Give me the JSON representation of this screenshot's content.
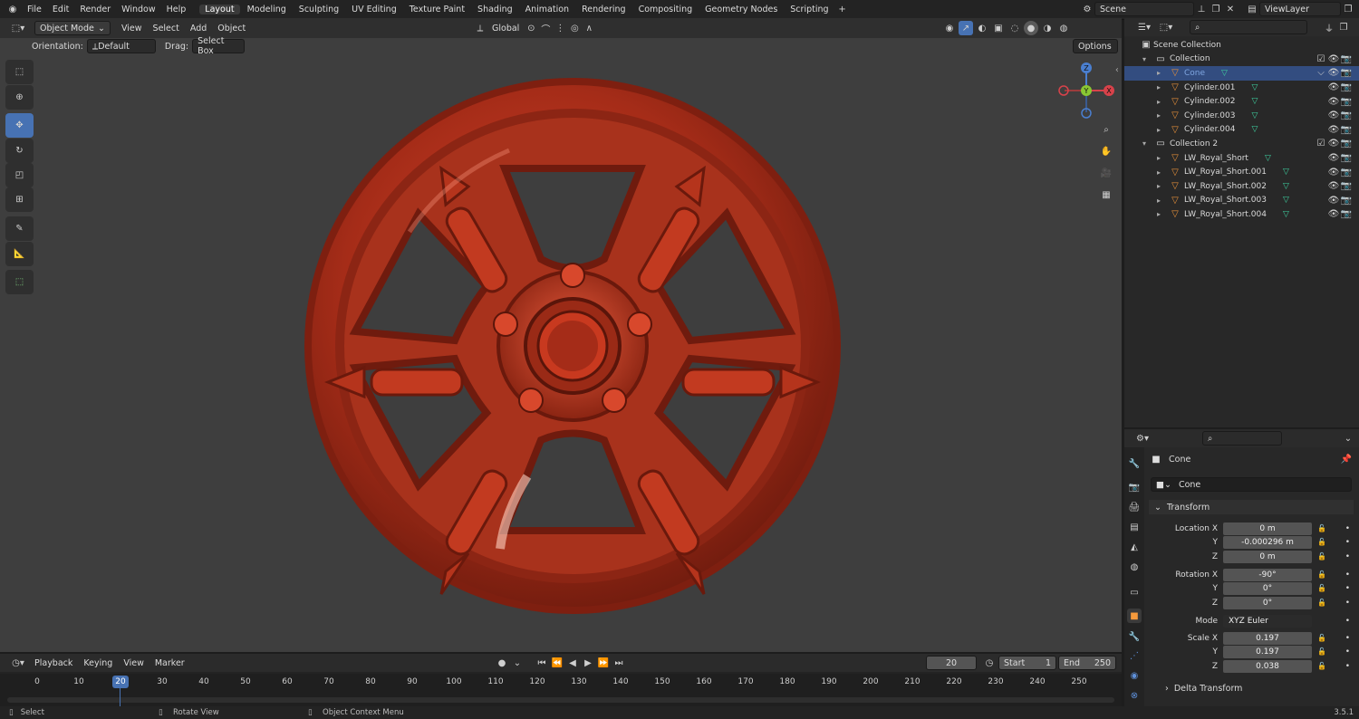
{
  "app": {
    "menus": [
      "File",
      "Edit",
      "Render",
      "Window",
      "Help"
    ],
    "workspaces": [
      "Layout",
      "Modeling",
      "Sculpting",
      "UV Editing",
      "Texture Paint",
      "Shading",
      "Animation",
      "Rendering",
      "Compositing",
      "Geometry Nodes",
      "Scripting"
    ],
    "active_workspace": "Layout",
    "scene": "Scene",
    "view_layer": "ViewLayer"
  },
  "viewport_header": {
    "mode": "Object Mode",
    "menus": [
      "View",
      "Select",
      "Add",
      "Object"
    ],
    "transform_orientation": "Global",
    "options": "Options"
  },
  "tool_options": {
    "orientation_label": "Orientation:",
    "orientation_value": "Default",
    "drag_label": "Drag:",
    "drag_value": "Select Box"
  },
  "tools": [
    "select-box-tool",
    "cursor-tool",
    "move-tool",
    "rotate-tool",
    "scale-tool",
    "transform-tool",
    "annotate-tool",
    "measure-tool",
    "add-cube-tool"
  ],
  "gizmo": {
    "z": "Z",
    "y": "Y",
    "x": "X"
  },
  "outliner": {
    "root": "Scene Collection",
    "items": [
      {
        "name": "Collection",
        "level": 0,
        "type": "collection"
      },
      {
        "name": "Cone",
        "level": 1,
        "type": "object",
        "selected": true
      },
      {
        "name": "Cylinder.001",
        "level": 1,
        "type": "object"
      },
      {
        "name": "Cylinder.002",
        "level": 1,
        "type": "object"
      },
      {
        "name": "Cylinder.003",
        "level": 1,
        "type": "object"
      },
      {
        "name": "Cylinder.004",
        "level": 1,
        "type": "object"
      },
      {
        "name": "Collection 2",
        "level": 0,
        "type": "collection"
      },
      {
        "name": "LW_Royal_Short",
        "level": 1,
        "type": "object"
      },
      {
        "name": "LW_Royal_Short.001",
        "level": 1,
        "type": "object"
      },
      {
        "name": "LW_Royal_Short.002",
        "level": 1,
        "type": "object"
      },
      {
        "name": "LW_Royal_Short.003",
        "level": 1,
        "type": "object"
      },
      {
        "name": "LW_Royal_Short.004",
        "level": 1,
        "type": "object"
      }
    ]
  },
  "properties": {
    "object_name": "Cone",
    "data_name": "Cone",
    "panel": "Transform",
    "delta": "Delta Transform",
    "location": {
      "label": "Location X",
      "x": "0 m",
      "y": "-0.000296 m",
      "z": "0 m"
    },
    "rotation": {
      "label": "Rotation X",
      "x": "-90°",
      "y": "0°",
      "z": "0°"
    },
    "mode": {
      "label": "Mode",
      "value": "XYZ Euler"
    },
    "scale": {
      "label": "Scale X",
      "x": "0.197",
      "y": "0.197",
      "z": "0.038"
    },
    "axis_y": "Y",
    "axis_z": "Z"
  },
  "timeline": {
    "menus": [
      "Playback",
      "Keying",
      "View",
      "Marker"
    ],
    "current_frame": "20",
    "start_label": "Start",
    "start": "1",
    "end_label": "End",
    "end": "250",
    "ticks": [
      "0",
      "10",
      "20",
      "30",
      "40",
      "50",
      "60",
      "70",
      "80",
      "90",
      "100",
      "110",
      "120",
      "130",
      "140",
      "150",
      "160",
      "170",
      "180",
      "190",
      "200",
      "210",
      "220",
      "230",
      "240",
      "250"
    ]
  },
  "status": {
    "select": "Select",
    "rotate": "Rotate View",
    "context": "Object Context Menu",
    "version": "3.5.1"
  },
  "colors": {
    "accent": "#4772b3",
    "wheel": "#b8301b",
    "viewport": "#3e3e3e"
  }
}
